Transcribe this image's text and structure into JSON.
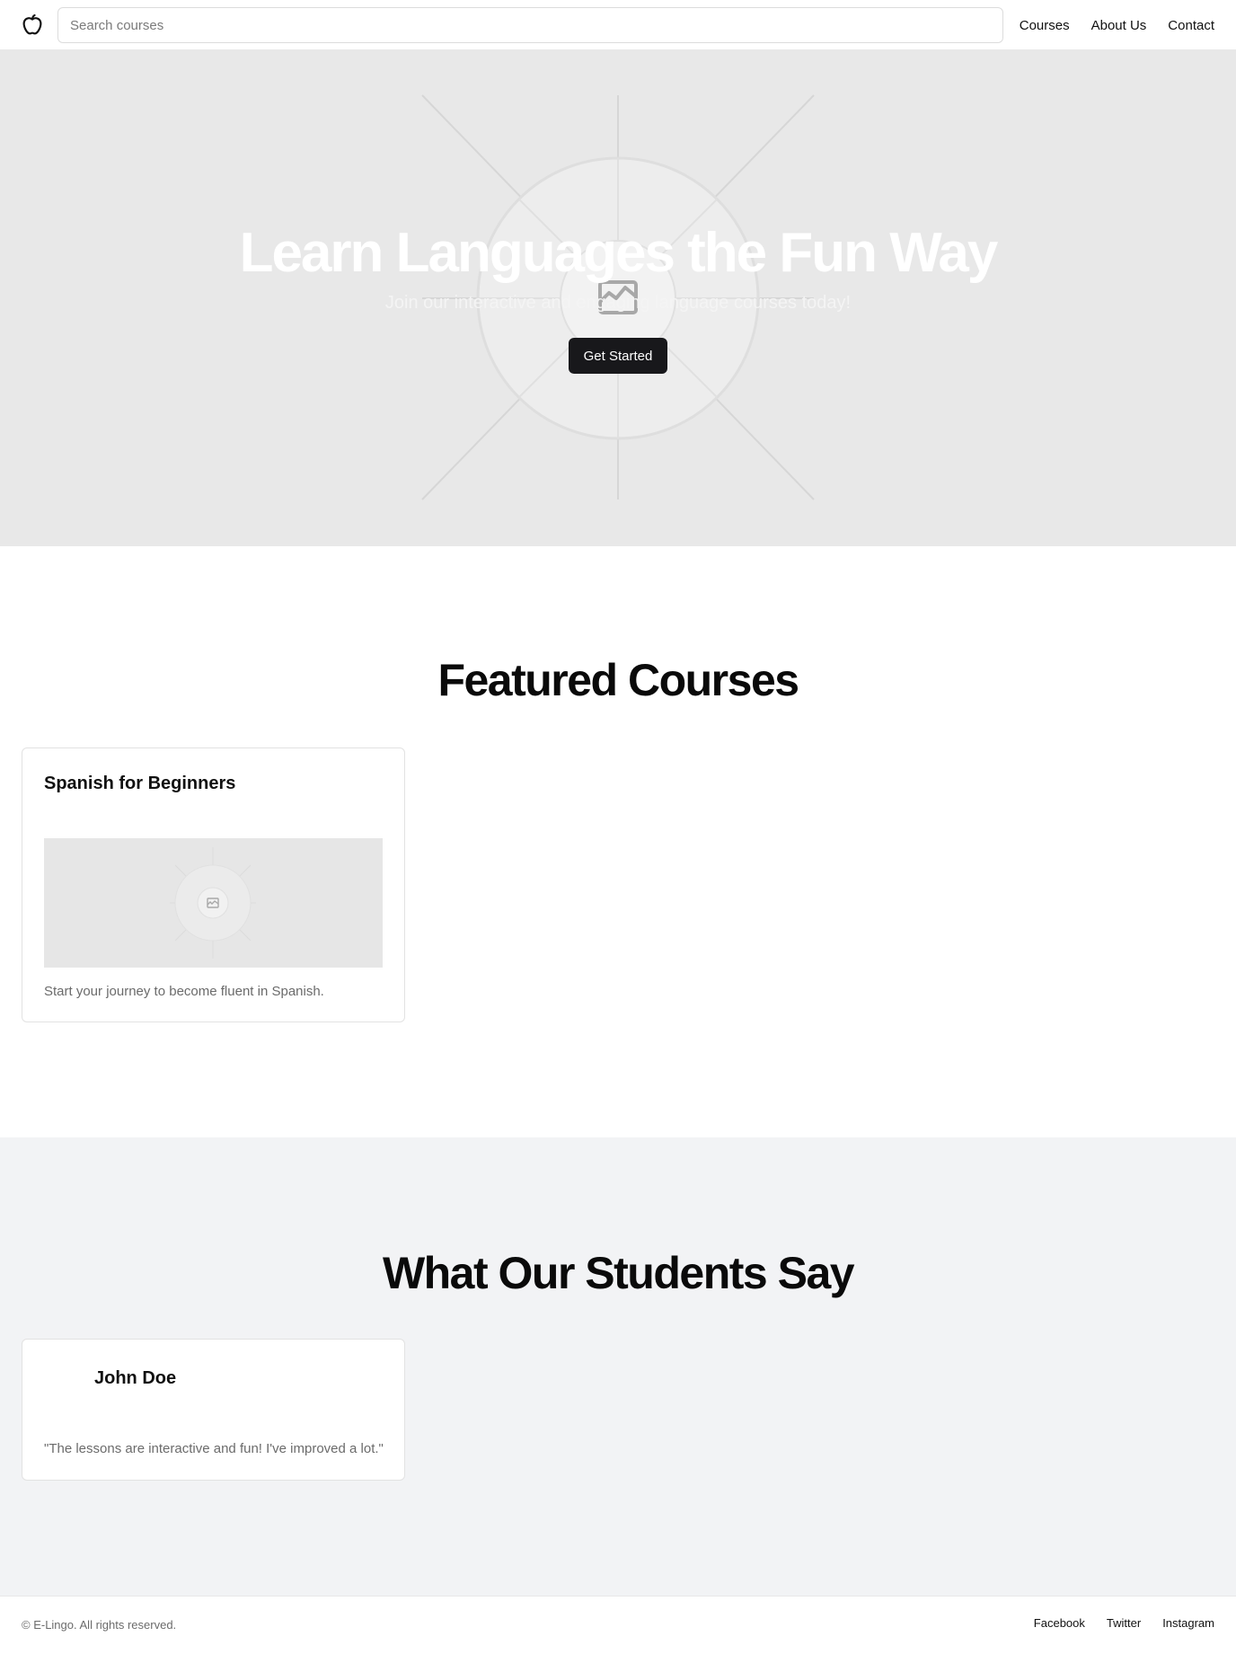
{
  "header": {
    "logo_icon": "apple-icon",
    "search_placeholder": "Search courses",
    "nav": [
      {
        "label": "Courses"
      },
      {
        "label": "About Us"
      },
      {
        "label": "Contact"
      }
    ]
  },
  "hero": {
    "title": "Learn Languages the Fun Way",
    "subtitle": "Join our interactive and engaging language courses today!",
    "cta_label": "Get Started",
    "background_icon": "image-placeholder-icon"
  },
  "featured": {
    "heading": "Featured Courses",
    "courses": [
      {
        "title": "Spanish for Beginners",
        "image_icon": "image-placeholder-icon",
        "description": "Start your journey to become fluent in Spanish."
      }
    ]
  },
  "testimonials": {
    "heading": "What Our Students Say",
    "items": [
      {
        "name": "John Doe",
        "quote": "\"The lessons are interactive and fun! I've improved a lot.\""
      }
    ]
  },
  "footer": {
    "copyright": "© E-Lingo. All rights reserved.",
    "links": [
      {
        "label": "Facebook"
      },
      {
        "label": "Twitter"
      },
      {
        "label": "Instagram"
      }
    ]
  },
  "colors": {
    "hero_bg": "#e8e8e8",
    "cta_bg": "#18181b",
    "testimonials_bg": "#f2f3f5",
    "muted_text": "#6b6b6b"
  }
}
